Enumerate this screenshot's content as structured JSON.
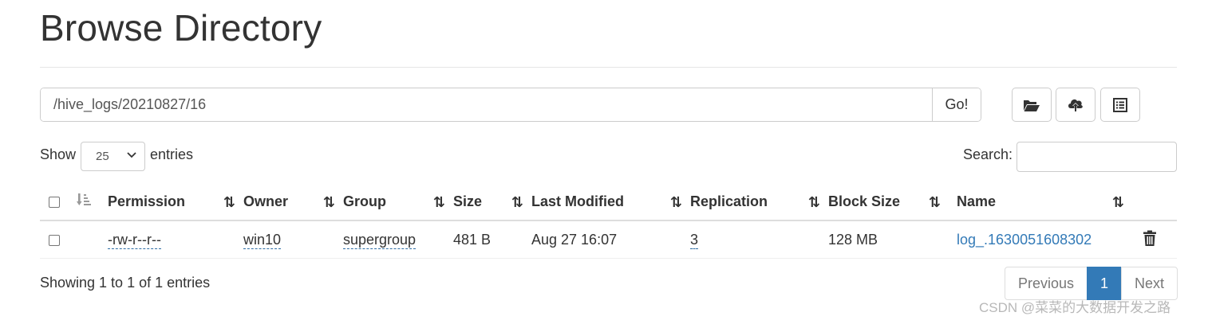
{
  "page": {
    "title": "Browse Directory"
  },
  "path_bar": {
    "value": "/hive_logs/20210827/16",
    "go_label": "Go!"
  },
  "toolbar": {
    "icons": [
      "folder-open-icon",
      "cloud-upload-icon",
      "list-alt-icon"
    ]
  },
  "length_menu": {
    "show_label": "Show",
    "selected": "25",
    "entries_label": "entries"
  },
  "search": {
    "label": "Search:",
    "value": ""
  },
  "table": {
    "columns": [
      "Permission",
      "Owner",
      "Group",
      "Size",
      "Last Modified",
      "Replication",
      "Block Size",
      "Name"
    ],
    "rows": [
      {
        "permission": "-rw-r--r--",
        "owner": "win10",
        "group": "supergroup",
        "size": "481 B",
        "last_modified": "Aug 27 16:07",
        "replication": "3",
        "block_size": "128 MB",
        "name": "log_.1630051608302"
      }
    ]
  },
  "info": "Showing 1 to 1 of 1 entries",
  "pagination": {
    "previous": "Previous",
    "current": "1",
    "next": "Next"
  },
  "watermark": "CSDN @菜菜的大数据开发之路",
  "colors": {
    "link": "#337ab7",
    "active_page": "#337ab7",
    "border": "#cccccc"
  }
}
